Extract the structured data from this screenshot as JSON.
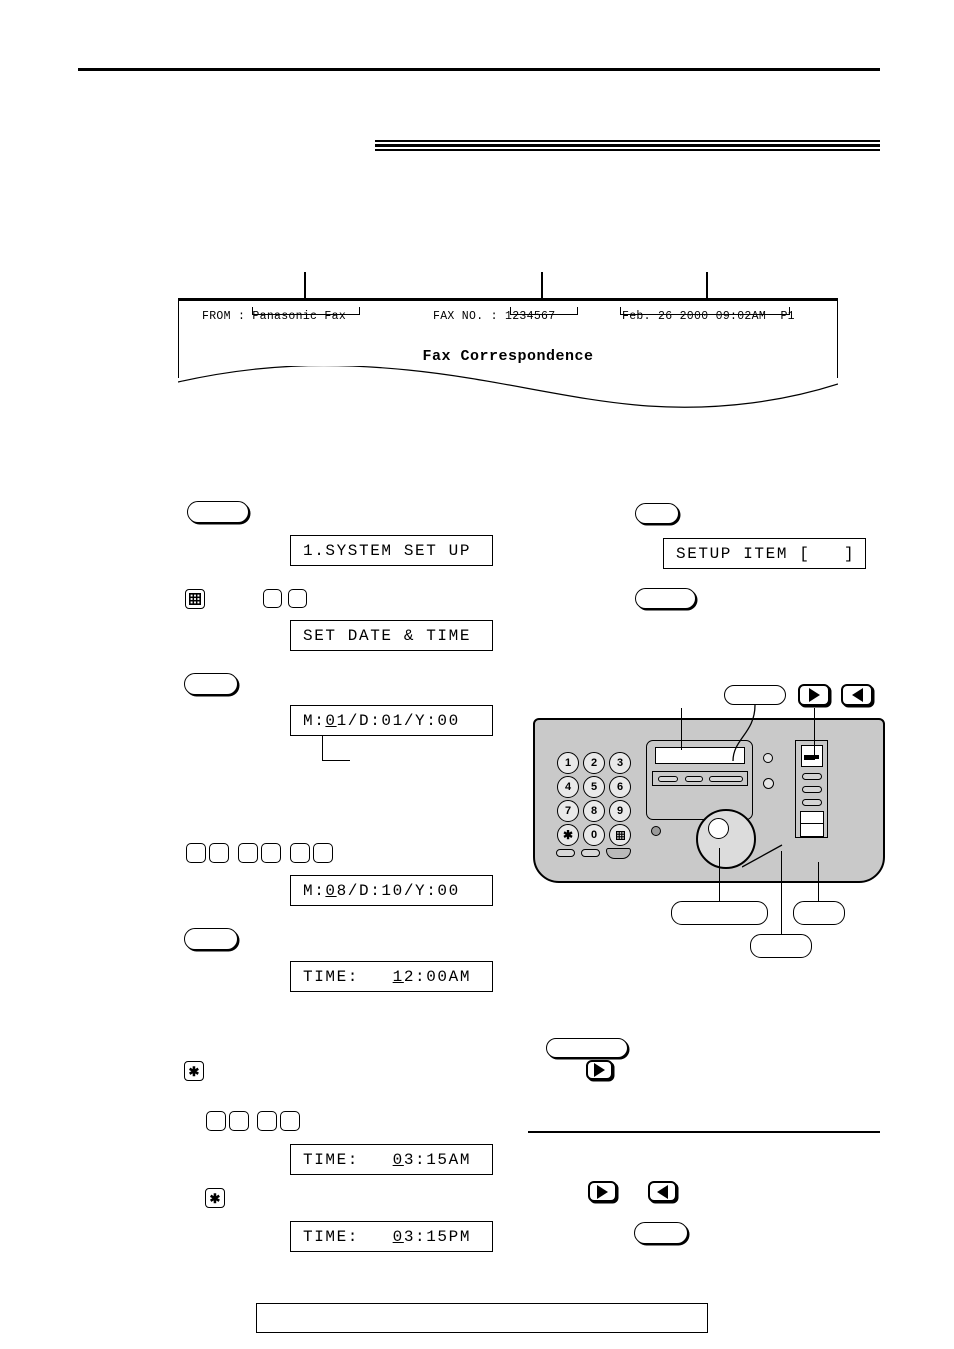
{
  "fax_sheet": {
    "from_label": "FROM :",
    "from_value": "Panasonic Fax",
    "faxno_label": "FAX NO. :",
    "faxno_value": "1234567",
    "datetime_value": "Feb. 26 2000 09:02AM",
    "page_value": "P1",
    "subject": "Fax Correspondence"
  },
  "displays": {
    "system_setup": "1.SYSTEM SET UP",
    "setup_item": "SETUP ITEM [   ]",
    "set_date_time": "SET DATE & TIME",
    "date_default_pre": "M:",
    "date_default": "M:01/D:01/Y:00",
    "date_entered": "M:08/D:10/Y:00",
    "time_default": "TIME:   12:00AM",
    "time_entered_am": "TIME:   03:15AM",
    "time_entered_pm": "TIME:   03:15PM"
  },
  "date_default_parts": {
    "a": "M:",
    "u": "0",
    "b": "1/D:01/Y:00"
  },
  "date_entered_parts": {
    "a": "M:",
    "u": "0",
    "b": "8/D:10/Y:00"
  },
  "time_default_parts": {
    "a": "TIME:   ",
    "u": "1",
    "b": "2:00AM"
  },
  "time_am_parts": {
    "a": "TIME:   ",
    "u": "0",
    "b": "3:15AM"
  },
  "time_pm_parts": {
    "a": "TIME:   ",
    "u": "0",
    "b": "3:15PM"
  },
  "keys": {
    "hash_glyph": "#",
    "star_glyph": "✱",
    "blank": ""
  },
  "keypad": {
    "digits": [
      "1",
      "2",
      "3",
      "4",
      "5",
      "6",
      "7",
      "8",
      "9"
    ],
    "star": "✱",
    "zero": "0",
    "hash": "#"
  },
  "buttons": {
    "menu_left_1": "",
    "menu_left_2": "",
    "menu_left_3": "",
    "menu_right_1": "",
    "menu_right_2": "",
    "set_button": "",
    "arrow_right": "▶",
    "arrow_left": "◀"
  },
  "callouts": {
    "display_label": "",
    "set_label": "",
    "navigator_label": "",
    "stop_label": "",
    "start_label": ""
  },
  "bottom_box": {
    "text": ""
  },
  "colors": {
    "ink": "#000000",
    "page": "#ffffff",
    "machine_body": "#c9c9c9",
    "key_fill": "#e9e9e9"
  }
}
